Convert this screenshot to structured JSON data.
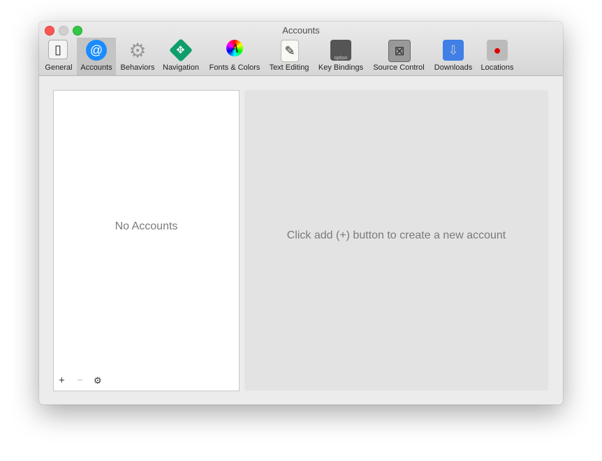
{
  "window": {
    "title": "Accounts"
  },
  "toolbar": {
    "items": [
      {
        "label": "General",
        "icon": "switch-icon"
      },
      {
        "label": "Accounts",
        "icon": "at-sign-icon",
        "selected": true
      },
      {
        "label": "Behaviors",
        "icon": "gear-icon"
      },
      {
        "label": "Navigation",
        "icon": "navigation-arrows-icon"
      },
      {
        "label": "Fonts & Colors",
        "icon": "font-color-wheel-icon"
      },
      {
        "label": "Text Editing",
        "icon": "pencil-document-icon"
      },
      {
        "label": "Key Bindings",
        "icon": "option-key-icon"
      },
      {
        "label": "Source Control",
        "icon": "vault-icon"
      },
      {
        "label": "Downloads",
        "icon": "download-icon"
      },
      {
        "label": "Locations",
        "icon": "joystick-drive-icon"
      }
    ]
  },
  "accounts_list": {
    "empty_text": "No Accounts",
    "add": "+",
    "remove": "−",
    "settings": "⚙"
  },
  "detail": {
    "hint": "Click add (+) button to create a new account"
  },
  "colors": {
    "accent": "#1a8cff",
    "close": "#fc5753",
    "zoom": "#33c748"
  }
}
